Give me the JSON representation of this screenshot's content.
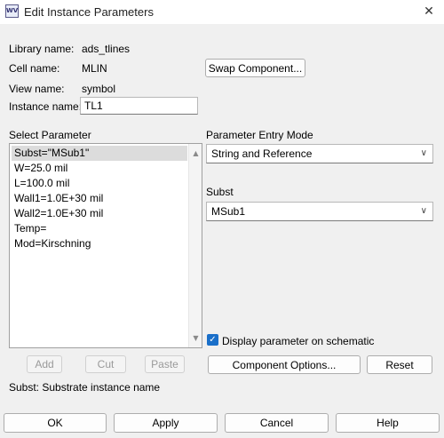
{
  "window": {
    "title": "Edit Instance Parameters",
    "icon": "ads-app-icon",
    "icon_text": "WV",
    "close_glyph": "✕"
  },
  "info": {
    "library_label": "Library name:",
    "library_value": "ads_tlines",
    "cell_label": "Cell name:",
    "cell_value": "MLIN",
    "view_label": "View name:",
    "view_value": "symbol",
    "instance_label": "Instance name:",
    "instance_value": "TL1",
    "swap_button": "Swap Component..."
  },
  "select_parameter": {
    "label": "Select Parameter",
    "items": [
      "Subst=\"MSub1\"",
      "W=25.0 mil",
      "L=100.0 mil",
      "Wall1=1.0E+30 mil",
      "Wall2=1.0E+30 mil",
      "Temp=",
      "Mod=Kirschning"
    ],
    "selected_index": 0,
    "scroll_up": "▲",
    "scroll_down": "▼"
  },
  "entry_mode": {
    "label": "Parameter Entry Mode",
    "value": "String and Reference",
    "chevron": "∨"
  },
  "subst": {
    "label": "Subst",
    "value": "MSub1",
    "chevron": "∨"
  },
  "display_checkbox": {
    "label": "Display parameter on schematic",
    "checked": true,
    "check_glyph": "✓"
  },
  "list_buttons": {
    "add": "Add",
    "cut": "Cut",
    "paste": "Paste"
  },
  "component_options_button": "Component Options...",
  "reset_button": "Reset",
  "status_text": "Subst: Substrate instance name",
  "footer": {
    "ok": "OK",
    "apply": "Apply",
    "cancel": "Cancel",
    "help": "Help"
  },
  "colors": {
    "accent": "#1a6fc9",
    "selection": "#dcdcdc",
    "background": "#f0f0f0"
  }
}
